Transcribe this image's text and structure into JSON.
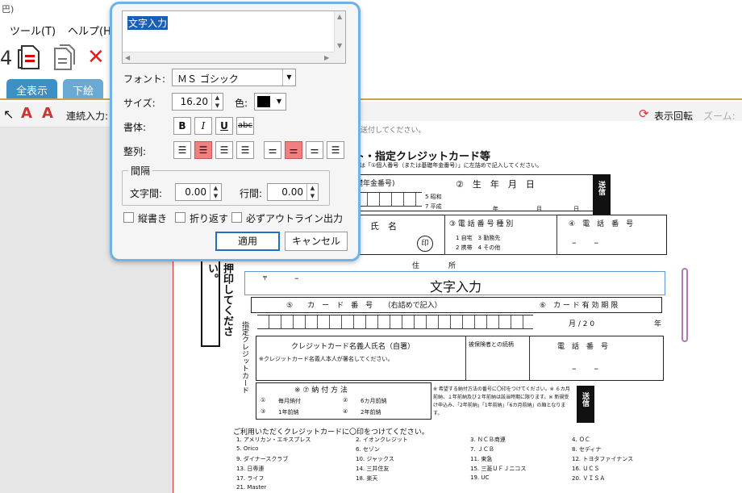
{
  "titlebar": {
    "title": "巴)"
  },
  "menu": [
    {
      "label": "ツール(T)"
    },
    {
      "label": "ヘルプ(H"
    }
  ],
  "tabs": [
    {
      "label": "全表示"
    },
    {
      "label": "下絵"
    }
  ],
  "subbar": {
    "continuous_label": "連続入力:",
    "rotate_label": "表示回転",
    "zoom_label": "ズーム:"
  },
  "dialog": {
    "text_value": "文字入力",
    "font_label": "フォント:",
    "font_value": "ＭＳ ゴシック",
    "size_label": "サイズ:",
    "size_value": "16.20",
    "color_label": "色:",
    "color_value": "#000000",
    "style_label": "書体:",
    "style_bold": "B",
    "style_italic": "I",
    "style_underline": "U",
    "style_strike": "abc",
    "align_label": "整列:",
    "spacing_group": "間隔",
    "char_spacing_label": "文字間:",
    "char_spacing_value": "0.00",
    "line_spacing_label": "行間:",
    "line_spacing_value": "0.00",
    "vertical_label": "縦書き",
    "wrap_label": "折り返す",
    "outline_label": "必ずアウトライン出力",
    "apply_label": "適用",
    "cancel_label": "キャンセル"
  },
  "form": {
    "heading": "ト・指定クレジットカード等",
    "subheading": "合は「①個人番号（または基礎年金番号）」に左詰めで記入してください。",
    "top_note": "送付してください。",
    "pension_no": "礎年金番号)",
    "birth_header": "②　生　年　月　日",
    "era_showa": "5 昭和",
    "era_heisei": "7 平成",
    "year_unit": "年",
    "month_unit": "月",
    "day_unit": "日",
    "send_label": "送信",
    "name_header": "氏　名",
    "seal_label": "印",
    "phone_type_header": "③ 電 話 番 号 種 別",
    "phone_type_1": "1 自宅　3 勤務先",
    "phone_type_2": "2 携帯　4 その他",
    "phone_header": "④　電　話　番　号",
    "dash": "–　　–",
    "address_header": "住　　　　所",
    "postal_mark": "〒",
    "postal_dash": "–",
    "text_input_display": "文字入力",
    "card_no_header": "⑤　　カ　ー　ド　番　号　　（右詰めで記入）",
    "expiry_header": "⑥　カ ー ド 有 効 期 限",
    "expiry_slash": "月 /  2  0",
    "expiry_year": "年",
    "card_label_vertical": "指定クレジットカード",
    "holder_header": "クレジットカード名義人氏名（自署）",
    "holder_note": "※クレジットカード名義人本人が署名してください。",
    "relation_header": "被保険者との続柄",
    "phone_header2": "電　話　番　号",
    "payment_header": "※ ⑦ 納 付 方 法",
    "pay_1_no": "①",
    "pay_1": "毎月納付",
    "pay_2_no": "②",
    "pay_2": "6カ月前納",
    "pay_3_no": "③",
    "pay_3": "1年前納",
    "pay_4_no": "④",
    "pay_4": "2年前納",
    "pay_note": "※ 希望する納付方法の番号に〇印をつけてください。※ ６カ月前納、１年前納及び２年前納は該当時期に限ります。※ 新規受け申込み、「2年前納」「1年前納」「6カ月前納」の順となります。",
    "side_vertical": "押印してください。",
    "card_list_header": "ご利用いただくクレジットカードに〇印をつけてください。",
    "cards": [
      "1. アメリカン・エキスプレス",
      "2. イオンクレジット",
      "3. ＮＣＢ商連",
      "4. ＯＣ",
      "5. Orico",
      "6. セゾン",
      "7. ＪＣＢ",
      "8. セディナ",
      "9. ダイナースクラブ",
      "10. ジャックス",
      "11. 東急",
      "12. トヨタファイナンス",
      "13. 日専連",
      "14. 三井住友",
      "15. 三菱ＵＦＪニコス",
      "16. ＵＣＳ",
      "17. ライフ",
      "18. 楽天",
      "19. UC",
      "20. ＶＩＳＡ",
      "21. Master"
    ]
  }
}
